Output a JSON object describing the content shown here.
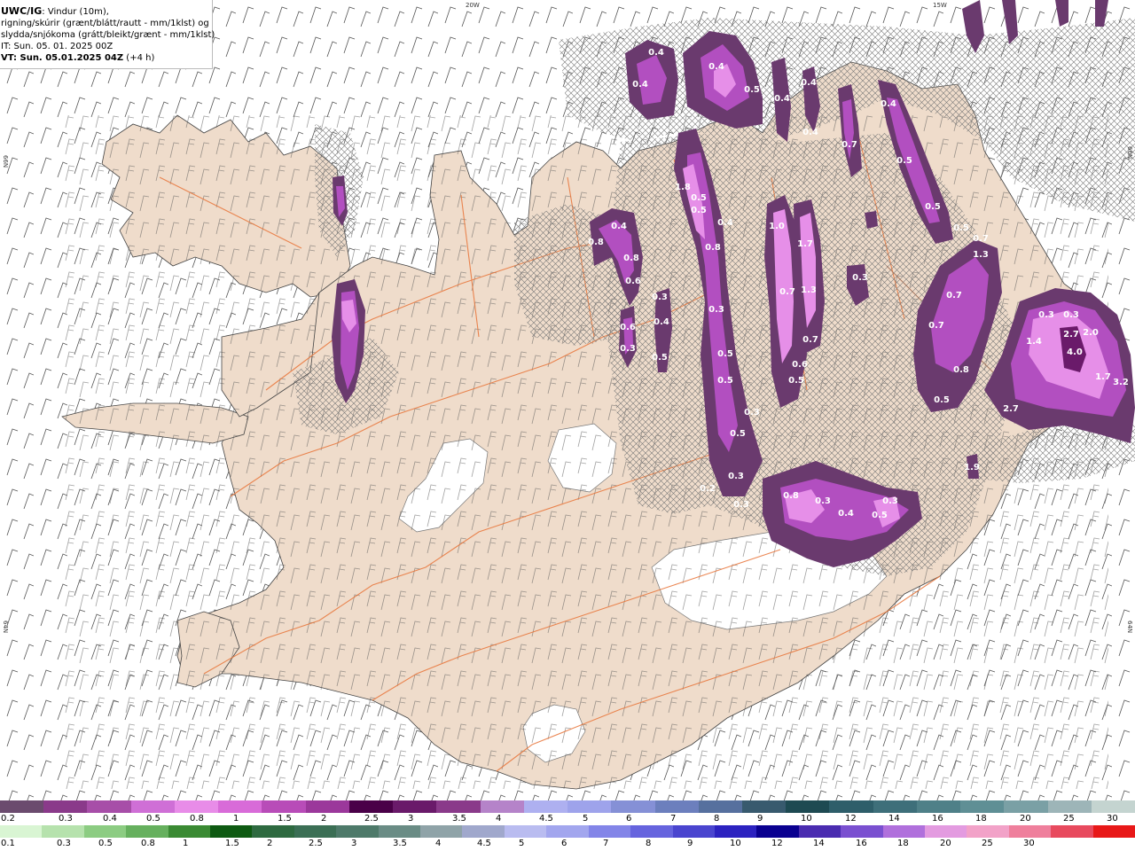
{
  "header": {
    "model": "UWC/IG",
    "line1_rest": ": Vindur (10m),",
    "line2": "rigning/skúrir (grænt/blátt/rautt - mm/1klst) og",
    "line3": "slydda/snjókoma (grátt/bleikt/grænt - mm/1klst)",
    "line4": "IT: Sun. 05. 01. 2025 00Z",
    "line5_bold": "VT: Sun. 05.01.2025 04Z",
    "line5_rest": " (+4 h)"
  },
  "graticule": {
    "top_20w": "20W",
    "top_15w": "15W",
    "left_66n": "66N",
    "left_64n": "64N",
    "right_66n": "66N",
    "right_64n": "64N"
  },
  "colors": {
    "land": "#efdccb",
    "sea": "#ffffff",
    "roads": "#e8753a",
    "precip_light": "#e68fe8",
    "precip_mid": "#b24fc0",
    "precip_dark": "#6a3a6e"
  },
  "precip_values": [
    "0.4",
    "0.4",
    "0.4",
    "0.5",
    "0.4",
    "0.4",
    "0.4",
    "1.8",
    "0.5",
    "0.5",
    "0.4",
    "0.8",
    "0.4",
    "0.8",
    "0.6",
    "0.6",
    "0.3",
    "0.3",
    "0.4",
    "0.5",
    "0.8",
    "0.3",
    "0.5",
    "0.5",
    "0.5",
    "0.3",
    "0.2",
    "0.3",
    "0.3",
    "1.0",
    "1.7",
    "0.7",
    "1.3",
    "0.7",
    "0.6",
    "0.5",
    "0.3",
    "0.7",
    "0.4",
    "0.5",
    "0.5",
    "0.5",
    "0.7",
    "1.3",
    "0.7",
    "0.7",
    "0.8",
    "0.5",
    "0.3",
    "0.3",
    "1.4",
    "2.7",
    "2.0",
    "4.0",
    "1.7",
    "3.2",
    "2.7",
    "1.9",
    "0.8",
    "0.3",
    "0.4",
    "0.5",
    "0.3"
  ],
  "legend_snow": {
    "colors": [
      "#6b4b6e",
      "#8a3a8a",
      "#a74ea8",
      "#cf6fd6",
      "#e88ce8",
      "#d86bd8",
      "#b84cb8",
      "#9b389b",
      "#4a0048",
      "#6a1a6a",
      "#8a3a8a",
      "#b583c9",
      "#aeb0f0",
      "#9ea3eb",
      "#8590d6",
      "#6c7fbd",
      "#56709e",
      "#385a6e",
      "#1e4a52",
      "#2e5e6a",
      "#3e6f7a",
      "#4f8088",
      "#5f8f95",
      "#7aa0a5",
      "#9db5b8",
      "#c4d4d0"
    ],
    "labels": [
      "0.2",
      "0.3",
      "0.4",
      "0.5",
      "0.8",
      "1",
      "1.5",
      "2",
      "2.5",
      "3",
      "3.5",
      "4",
      "4.5",
      "5",
      "6",
      "7",
      "8",
      "9",
      "10",
      "12",
      "14",
      "16",
      "18",
      "20",
      "25",
      "30"
    ]
  },
  "legend_rain": {
    "colors": [
      "#d9f5d3",
      "#b6e2ad",
      "#8ccc82",
      "#66b05e",
      "#3a8a33",
      "#0e5a12",
      "#2e6a40",
      "#3b6f55",
      "#4e7a6a",
      "#6a8c85",
      "#8fa3a8",
      "#a0a8cc",
      "#b9bcf0",
      "#a2a6ee",
      "#8385e8",
      "#6664de",
      "#4a45cf",
      "#2c22c0",
      "#0a0090",
      "#4a2cb0",
      "#7a50d0",
      "#b070dc",
      "#e39be0",
      "#f2a2c8",
      "#ef7f9c",
      "#e84a5e",
      "#e81818"
    ],
    "labels": [
      "0.1",
      "0.3",
      "0.5",
      "0.8",
      "1",
      "1.5",
      "2",
      "2.5",
      "3",
      "3.5",
      "4",
      "4.5",
      "5",
      "6",
      "7",
      "8",
      "9",
      "10",
      "12",
      "14",
      "16",
      "18",
      "20",
      "25",
      "30"
    ]
  }
}
